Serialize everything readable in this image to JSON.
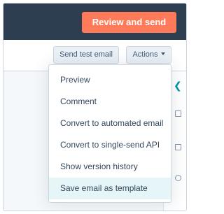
{
  "header": {
    "primary_button": "Review and send"
  },
  "toolbar": {
    "send_test_label": "Send test email",
    "actions_label": "Actions"
  },
  "actions_menu": {
    "items": [
      {
        "label": "Preview"
      },
      {
        "label": "Comment"
      },
      {
        "label": "Convert to automated email"
      },
      {
        "label": "Convert to single-send API"
      },
      {
        "label": "Show version history"
      },
      {
        "label": "Save email as template",
        "highlighted": true
      }
    ]
  },
  "side_panel": {
    "icons": [
      "chevron-left-icon",
      "module-icon",
      "document-icon",
      "settings-icon"
    ]
  },
  "colors": {
    "header_bg": "#2d3e50",
    "primary_button": "#ff7a59",
    "highlight": "#e5f5f8",
    "text": "#33475b",
    "accent": "#0091ae"
  }
}
